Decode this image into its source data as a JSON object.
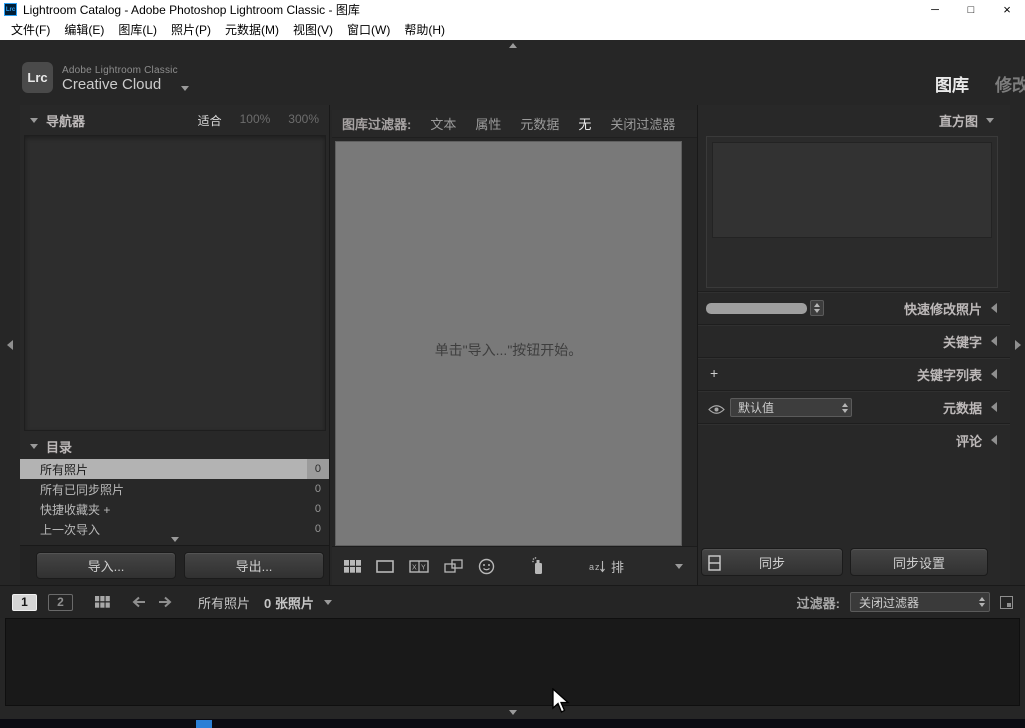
{
  "window": {
    "icon_label": "Lrc",
    "title": "Lightroom Catalog - Adobe Photoshop Lightroom Classic - 图库",
    "controls": {
      "minimize": "─",
      "maximize": "□",
      "close": "×"
    }
  },
  "menubar": {
    "items": [
      "文件(F)",
      "编辑(E)",
      "图库(L)",
      "照片(P)",
      "元数据(M)",
      "视图(V)",
      "窗口(W)",
      "帮助(H)"
    ]
  },
  "identity": {
    "logo": "Lrc",
    "line1": "Adobe Lightroom Classic",
    "line2": "Creative Cloud",
    "modules": [
      {
        "label": "图库"
      },
      {
        "label": "修改"
      }
    ]
  },
  "left_panel": {
    "navigator_title": "导航器",
    "zoom_options": [
      "适合",
      "100%",
      "300%"
    ],
    "catalog_title": "目录",
    "items": [
      {
        "label": "所有照片",
        "count": "0"
      },
      {
        "label": "所有已同步照片",
        "count": "0"
      },
      {
        "label": "快捷收藏夹 +",
        "count": "0"
      },
      {
        "label": "上一次导入",
        "count": "0"
      }
    ],
    "import_label": "导入...",
    "export_label": "导出..."
  },
  "center": {
    "filter_label": "图库过滤器:",
    "filter_options": [
      "文本",
      "属性",
      "元数据",
      "无",
      "关闭过滤器"
    ],
    "empty_message": "单击\"导入...\"按钮开始。",
    "sort_label": "排"
  },
  "right_panel": {
    "histogram_title": "直方图",
    "quick_develop_title": "快速修改照片",
    "keywording_title": "关键字",
    "keyword_list_title": "关键字列表",
    "keyword_list_plus": "+",
    "metadata_title": "元数据",
    "metadata_preset": "默认值",
    "comments_title": "评论",
    "sync_label": "同步",
    "sync_settings_label": "同步设置"
  },
  "filmstrip": {
    "monitor_1": "1",
    "monitor_2": "2",
    "source_label": "所有照片",
    "count_label": "0 张照片",
    "filter_label": "过滤器:",
    "filter_value": "关闭过滤器"
  },
  "colors": {
    "accent_blue": "#2b7fd6",
    "panel_bg": "#282828",
    "grid_bg": "#797979",
    "lr_icon_blue": "#2fa3f7"
  }
}
